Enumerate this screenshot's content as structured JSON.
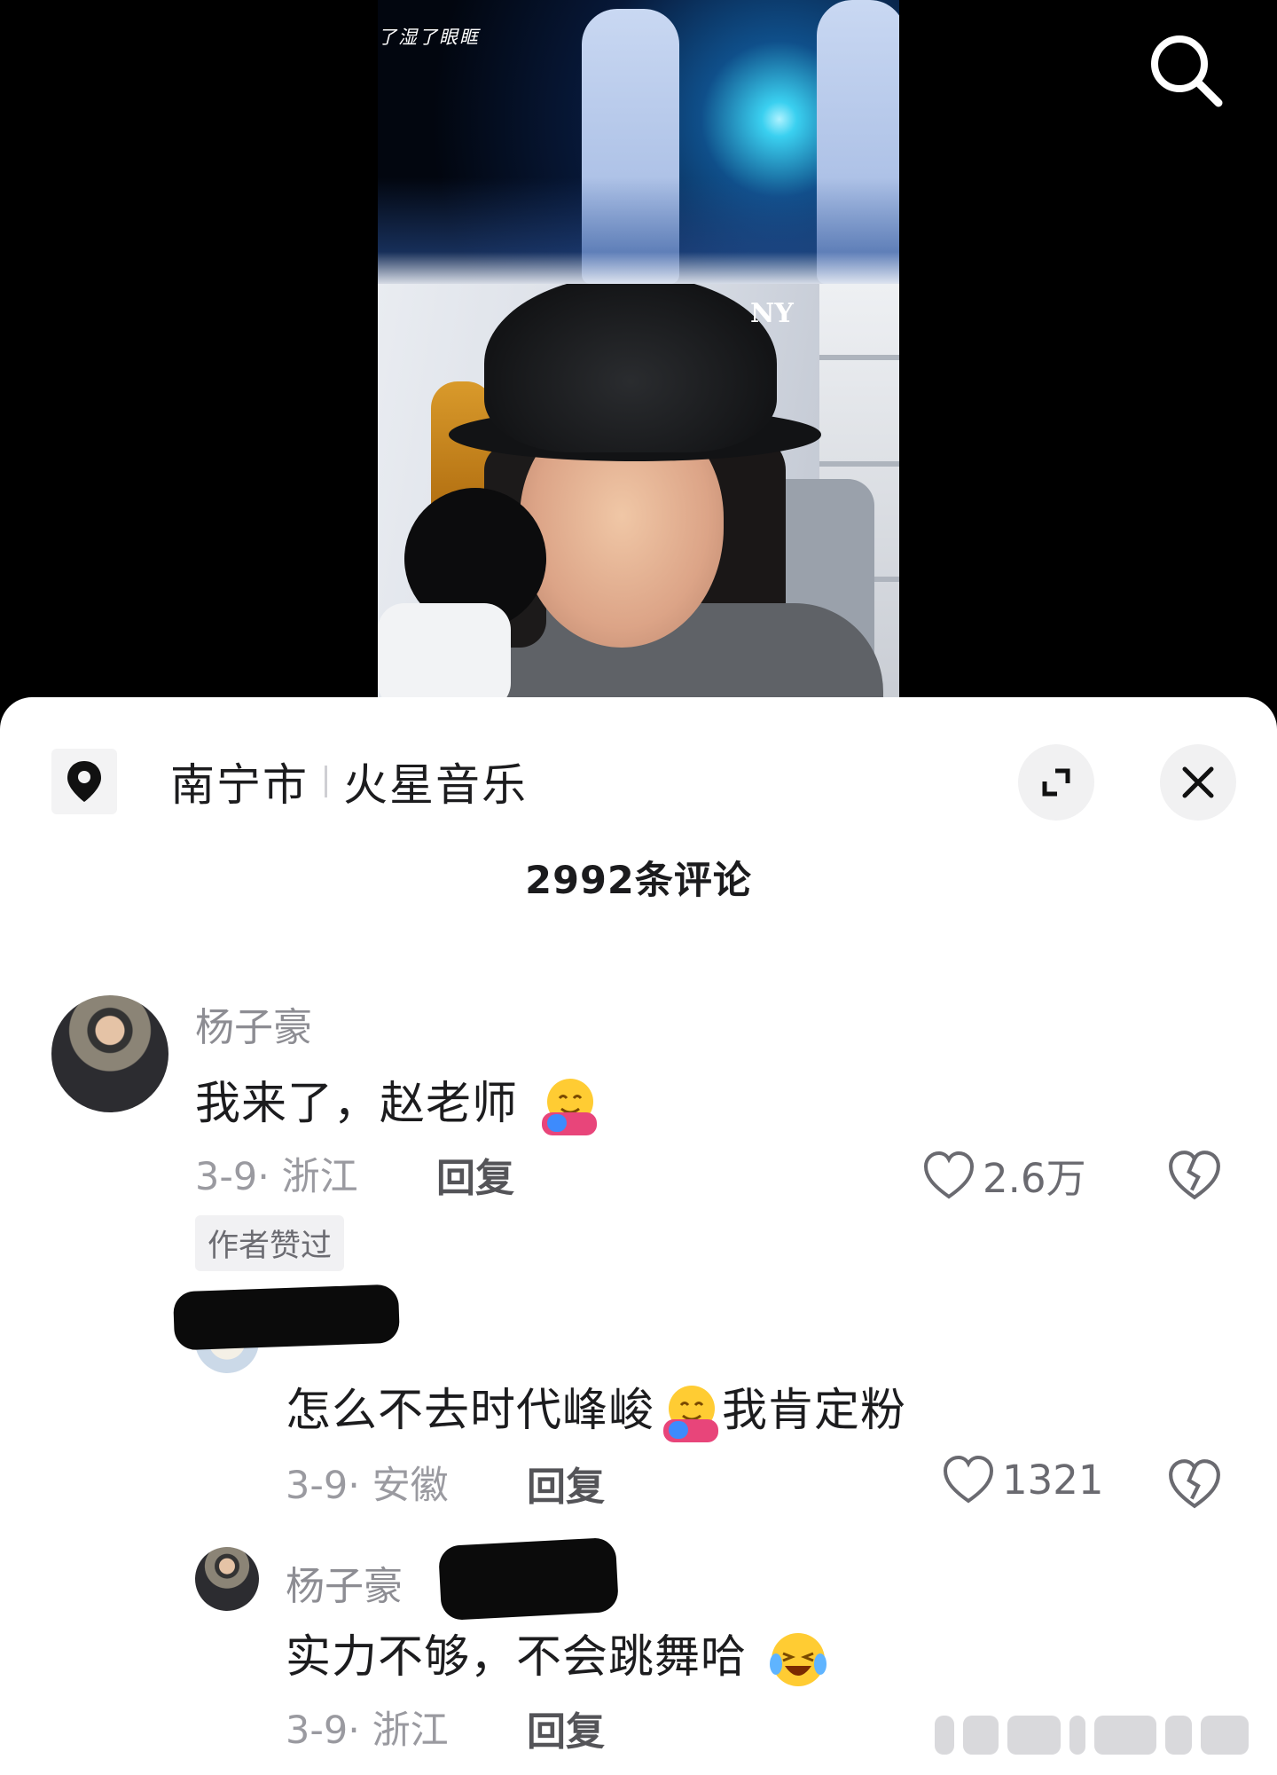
{
  "video": {
    "subtitle": "了湿了眼眶"
  },
  "panel": {
    "location": {
      "city": "南宁市",
      "venue": "火星音乐"
    },
    "comment_count": "2992条评论"
  },
  "comments": [
    {
      "username": "杨子豪",
      "text": "我来了，赵老师",
      "date_location": "3-9· 浙江",
      "reply_label": "回复",
      "likes": "2.6万",
      "tag": "作者赞过"
    },
    {
      "username": "",
      "text": "怎么不去时代峰峻",
      "text_after": "我肯定粉",
      "date_location": "3-9· 安徽",
      "reply_label": "回复",
      "likes": "1321"
    },
    {
      "username": "杨子豪",
      "text": "实力不够，不会跳舞哈",
      "date_location": "3-9· 浙江",
      "reply_label": "回复"
    }
  ],
  "icons": {
    "search": "search-icon",
    "location": "location-pin-icon",
    "expand": "expand-icon",
    "close": "close-icon",
    "like": "heart-outline-icon",
    "dislike": "broken-heart-icon"
  },
  "colors": {
    "panel_bg": "#ffffff",
    "text_primary": "#1c1c1e",
    "text_secondary": "#9a9aa0"
  }
}
